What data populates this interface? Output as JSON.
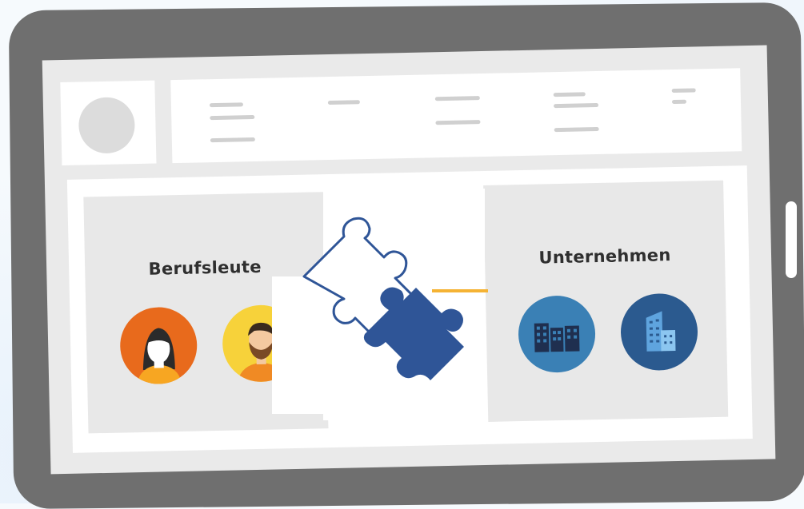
{
  "left_card": {
    "title": "Berufsleute",
    "people": [
      "woman-avatar-icon",
      "bearded-man-avatar-icon"
    ]
  },
  "right_card": {
    "title": "Unternehmen",
    "companies": [
      "office-buildings-icon",
      "skyscraper-icon"
    ]
  },
  "colors": {
    "tablet_frame": "#6f6f6f",
    "screen_bg": "#eaeaea",
    "card_bg": "#e8e8e8",
    "accent_orange": "#e86a1c",
    "accent_yellow": "#f7d23a",
    "company_blue": "#3a80b5",
    "company_blue_dark": "#2b5a8f",
    "puzzle_blue": "#2f5597",
    "connector": "#f5b334"
  },
  "icons": [
    "puzzle-piece-outline-icon",
    "puzzle-piece-filled-icon"
  ]
}
